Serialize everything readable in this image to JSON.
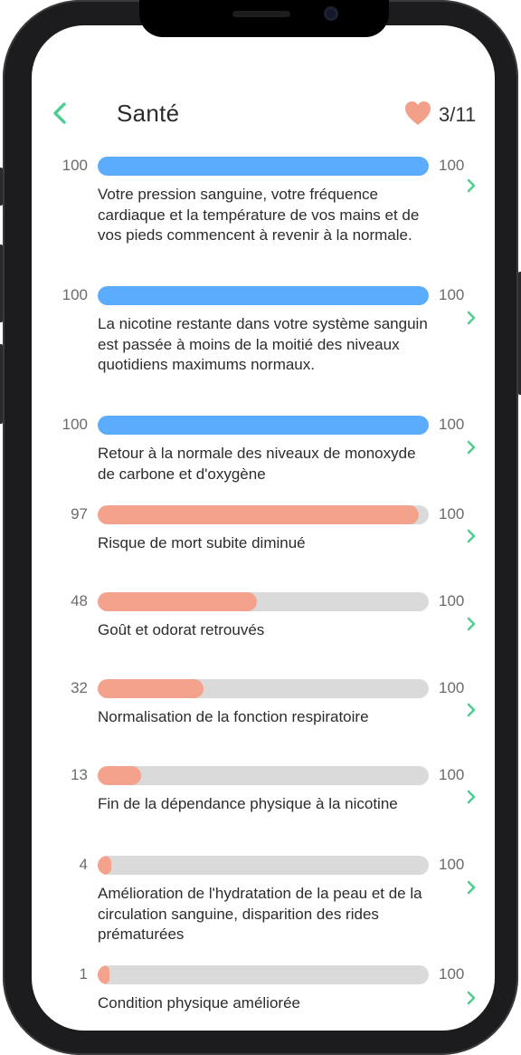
{
  "header": {
    "title": "Santé",
    "counter": "3/11"
  },
  "colors": {
    "accent_green": "#4fcf8f",
    "heart": "#f3a08b",
    "bar_complete": "#5cacfd",
    "bar_progress": "#f4a28c",
    "track": "#dadada"
  },
  "icons": {
    "back": "chevron-left-icon",
    "heart": "heart-icon",
    "row_action": "chevron-right-icon"
  },
  "items": [
    {
      "left": "100",
      "right": "100",
      "progress": 1.0,
      "status": "complete",
      "text": "Votre pression sanguine, votre fréquence cardiaque et la température de vos mains et de vos pieds commencent à revenir à la normale."
    },
    {
      "left": "100",
      "right": "100",
      "progress": 1.0,
      "status": "complete",
      "text": "La nicotine restante dans votre système sanguin est passée à moins de la moitié des niveaux quotidiens maximums normaux."
    },
    {
      "left": "100",
      "right": "100",
      "progress": 1.0,
      "status": "complete",
      "text": "Retour à la normale des niveaux de monoxyde de carbone et d'oxygène"
    },
    {
      "left": "97",
      "right": "100",
      "progress": 0.97,
      "status": "in_progress",
      "text": "Risque de mort subite diminué"
    },
    {
      "left": "48",
      "right": "100",
      "progress": 0.48,
      "status": "in_progress",
      "text": "Goût et odorat retrouvés"
    },
    {
      "left": "32",
      "right": "100",
      "progress": 0.32,
      "status": "in_progress",
      "text": "Normalisation de la fonction respiratoire"
    },
    {
      "left": "13",
      "right": "100",
      "progress": 0.13,
      "status": "in_progress",
      "text": "Fin de la dépendance physique à la nicotine"
    },
    {
      "left": "4",
      "right": "100",
      "progress": 0.04,
      "status": "in_progress",
      "text": "Amélioration de l'hydratation de la peau et de la circulation sanguine, disparition des rides prématurées"
    },
    {
      "left": "1",
      "right": "100",
      "progress": 0.01,
      "status": "in_progress",
      "text": "Condition physique améliorée"
    }
  ]
}
